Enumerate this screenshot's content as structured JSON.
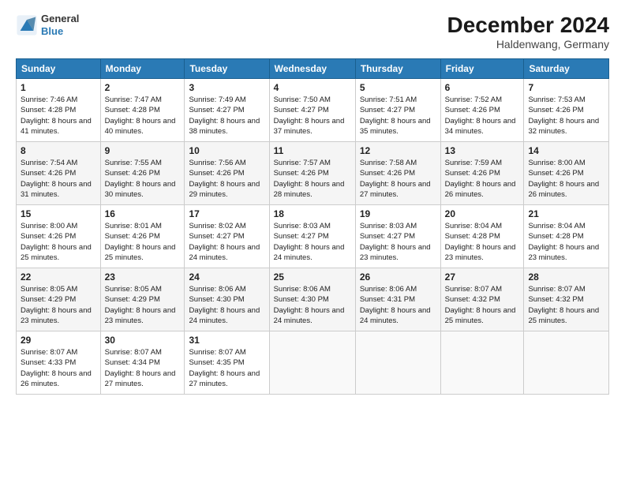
{
  "header": {
    "logo": {
      "line1": "General",
      "line2": "Blue"
    },
    "title": "December 2024",
    "location": "Haldenwang, Germany"
  },
  "calendar": {
    "days": [
      "Sunday",
      "Monday",
      "Tuesday",
      "Wednesday",
      "Thursday",
      "Friday",
      "Saturday"
    ],
    "rows": [
      [
        {
          "day": "1",
          "sunrise": "7:46 AM",
          "sunset": "4:28 PM",
          "daylight": "8 hours and 41 minutes."
        },
        {
          "day": "2",
          "sunrise": "7:47 AM",
          "sunset": "4:28 PM",
          "daylight": "8 hours and 40 minutes."
        },
        {
          "day": "3",
          "sunrise": "7:49 AM",
          "sunset": "4:27 PM",
          "daylight": "8 hours and 38 minutes."
        },
        {
          "day": "4",
          "sunrise": "7:50 AM",
          "sunset": "4:27 PM",
          "daylight": "8 hours and 37 minutes."
        },
        {
          "day": "5",
          "sunrise": "7:51 AM",
          "sunset": "4:27 PM",
          "daylight": "8 hours and 35 minutes."
        },
        {
          "day": "6",
          "sunrise": "7:52 AM",
          "sunset": "4:26 PM",
          "daylight": "8 hours and 34 minutes."
        },
        {
          "day": "7",
          "sunrise": "7:53 AM",
          "sunset": "4:26 PM",
          "daylight": "8 hours and 32 minutes."
        }
      ],
      [
        {
          "day": "8",
          "sunrise": "7:54 AM",
          "sunset": "4:26 PM",
          "daylight": "8 hours and 31 minutes."
        },
        {
          "day": "9",
          "sunrise": "7:55 AM",
          "sunset": "4:26 PM",
          "daylight": "8 hours and 30 minutes."
        },
        {
          "day": "10",
          "sunrise": "7:56 AM",
          "sunset": "4:26 PM",
          "daylight": "8 hours and 29 minutes."
        },
        {
          "day": "11",
          "sunrise": "7:57 AM",
          "sunset": "4:26 PM",
          "daylight": "8 hours and 28 minutes."
        },
        {
          "day": "12",
          "sunrise": "7:58 AM",
          "sunset": "4:26 PM",
          "daylight": "8 hours and 27 minutes."
        },
        {
          "day": "13",
          "sunrise": "7:59 AM",
          "sunset": "4:26 PM",
          "daylight": "8 hours and 26 minutes."
        },
        {
          "day": "14",
          "sunrise": "8:00 AM",
          "sunset": "4:26 PM",
          "daylight": "8 hours and 26 minutes."
        }
      ],
      [
        {
          "day": "15",
          "sunrise": "8:00 AM",
          "sunset": "4:26 PM",
          "daylight": "8 hours and 25 minutes."
        },
        {
          "day": "16",
          "sunrise": "8:01 AM",
          "sunset": "4:26 PM",
          "daylight": "8 hours and 25 minutes."
        },
        {
          "day": "17",
          "sunrise": "8:02 AM",
          "sunset": "4:27 PM",
          "daylight": "8 hours and 24 minutes."
        },
        {
          "day": "18",
          "sunrise": "8:03 AM",
          "sunset": "4:27 PM",
          "daylight": "8 hours and 24 minutes."
        },
        {
          "day": "19",
          "sunrise": "8:03 AM",
          "sunset": "4:27 PM",
          "daylight": "8 hours and 23 minutes."
        },
        {
          "day": "20",
          "sunrise": "8:04 AM",
          "sunset": "4:28 PM",
          "daylight": "8 hours and 23 minutes."
        },
        {
          "day": "21",
          "sunrise": "8:04 AM",
          "sunset": "4:28 PM",
          "daylight": "8 hours and 23 minutes."
        }
      ],
      [
        {
          "day": "22",
          "sunrise": "8:05 AM",
          "sunset": "4:29 PM",
          "daylight": "8 hours and 23 minutes."
        },
        {
          "day": "23",
          "sunrise": "8:05 AM",
          "sunset": "4:29 PM",
          "daylight": "8 hours and 23 minutes."
        },
        {
          "day": "24",
          "sunrise": "8:06 AM",
          "sunset": "4:30 PM",
          "daylight": "8 hours and 24 minutes."
        },
        {
          "day": "25",
          "sunrise": "8:06 AM",
          "sunset": "4:30 PM",
          "daylight": "8 hours and 24 minutes."
        },
        {
          "day": "26",
          "sunrise": "8:06 AM",
          "sunset": "4:31 PM",
          "daylight": "8 hours and 24 minutes."
        },
        {
          "day": "27",
          "sunrise": "8:07 AM",
          "sunset": "4:32 PM",
          "daylight": "8 hours and 25 minutes."
        },
        {
          "day": "28",
          "sunrise": "8:07 AM",
          "sunset": "4:32 PM",
          "daylight": "8 hours and 25 minutes."
        }
      ],
      [
        {
          "day": "29",
          "sunrise": "8:07 AM",
          "sunset": "4:33 PM",
          "daylight": "8 hours and 26 minutes."
        },
        {
          "day": "30",
          "sunrise": "8:07 AM",
          "sunset": "4:34 PM",
          "daylight": "8 hours and 27 minutes."
        },
        {
          "day": "31",
          "sunrise": "8:07 AM",
          "sunset": "4:35 PM",
          "daylight": "8 hours and 27 minutes."
        },
        null,
        null,
        null,
        null
      ]
    ]
  }
}
